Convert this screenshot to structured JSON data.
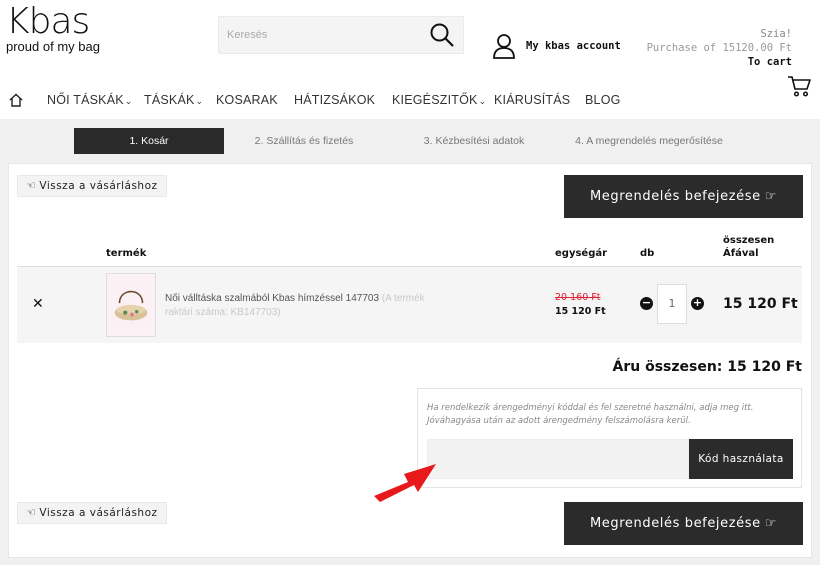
{
  "brand": {
    "logo": "Kbas",
    "tagline": "proud of my bag"
  },
  "search": {
    "placeholder": "Keresés"
  },
  "account": {
    "label": "My kbas account"
  },
  "cart_info": {
    "greeting": "Szia!",
    "purchase": "Purchase of 15120.00 Ft",
    "to_cart": "To cart"
  },
  "nav": {
    "items": [
      {
        "label": "NŐI TÁSKÁK",
        "has_dropdown": true
      },
      {
        "label": "TÁSKÁK",
        "has_dropdown": true
      },
      {
        "label": "KOSARAK",
        "has_dropdown": false
      },
      {
        "label": "HÁTIZSÁKOK",
        "has_dropdown": false
      },
      {
        "label": "KIEGÉSZITŐK",
        "has_dropdown": true
      },
      {
        "label": "KIÁRUSÍTÁS",
        "has_dropdown": false
      },
      {
        "label": "BLOG",
        "has_dropdown": false
      }
    ],
    "chevron": "⌄"
  },
  "steps": [
    {
      "label": "1. Kosár",
      "active": true
    },
    {
      "label": "2. Szállítás és fizetés",
      "active": false
    },
    {
      "label": "3. Kézbesítési adatok",
      "active": false
    },
    {
      "label": "4. A megrendelés megerősítése",
      "active": false
    }
  ],
  "actions": {
    "back_label": "Vissza a vásárláshoz",
    "finish_label": "Megrendelés befejezése"
  },
  "table": {
    "headers": {
      "product": "termék",
      "unit_price": "egységár",
      "qty": "db",
      "total_line1": "összesen",
      "total_line2": "Áfával"
    },
    "rows": [
      {
        "name": "Női válltáska szalmából Kbas hímzéssel 147703",
        "code": "(A termék raktári száma: KB147703)",
        "old_price": "20 160 Ft",
        "price": "15 120 Ft",
        "qty": "1",
        "total": "15 120 Ft"
      }
    ]
  },
  "summary": {
    "total_label": "Áru összesen: 15 120 Ft"
  },
  "coupon": {
    "description": "Ha rendelkezik árengedményi kóddal és fel szeretné használni, adja meg itt. Jóváhagyása után az adott árengedmény felszámolásra kerül.",
    "input_value": "",
    "button_label": "Kód használata"
  },
  "colors": {
    "dark": "#2b2b2b",
    "price_old": "#dd2233",
    "arrow": "#e8191b",
    "grey_bg": "#f0f0f0"
  }
}
